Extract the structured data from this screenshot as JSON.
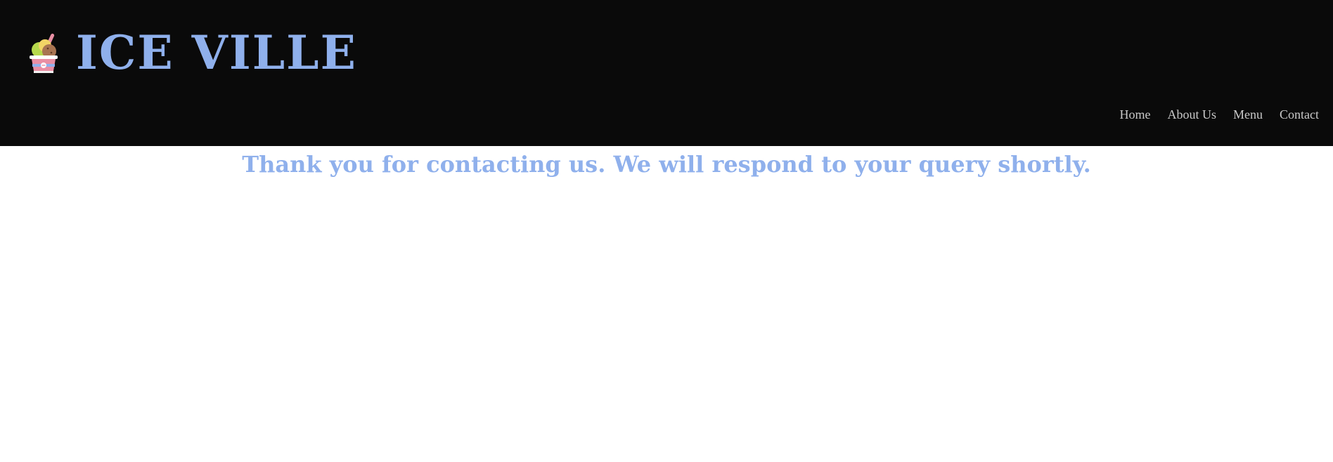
{
  "header": {
    "title": "ICE VILLE",
    "logo_icon": "ice-cream-cup-icon",
    "background_color": "#0a0a0a",
    "accent_color": "#8fb0ec"
  },
  "nav": {
    "items": [
      {
        "label": "Home"
      },
      {
        "label": "About Us"
      },
      {
        "label": "Menu"
      },
      {
        "label": "Contact"
      }
    ],
    "text_color": "#c9c9c9"
  },
  "main": {
    "message": "Thank you for contacting us. We will respond to your query shortly."
  }
}
